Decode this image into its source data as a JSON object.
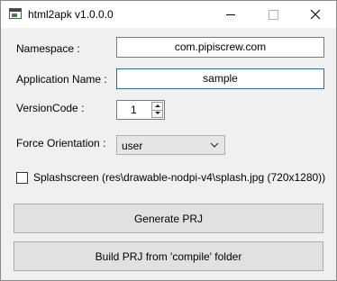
{
  "window": {
    "title": "html2apk v1.0.0.0",
    "icons": {
      "app": "app-window-icon",
      "minimize": "minimize-icon",
      "maximize": "maximize-icon",
      "close": "close-icon"
    }
  },
  "form": {
    "namespace": {
      "label": "Namespace :",
      "value": "com.pipiscrew.com"
    },
    "app_name": {
      "label": "Application Name :",
      "value": "sample"
    },
    "version_code": {
      "label": "VersionCode :",
      "value": "1"
    },
    "orientation": {
      "label": "Force Orientation :",
      "selected": "user"
    },
    "splashscreen": {
      "label": "Splashscreen (res\\drawable-nodpi-v4\\splash.jpg (720x1280))",
      "checked": false
    }
  },
  "buttons": {
    "generate": "Generate PRJ",
    "build": "Build PRJ from 'compile' folder"
  },
  "colors": {
    "focus": "#0078d7",
    "window_bg": "#f0f0f0",
    "button_bg": "#e1e1e1"
  }
}
